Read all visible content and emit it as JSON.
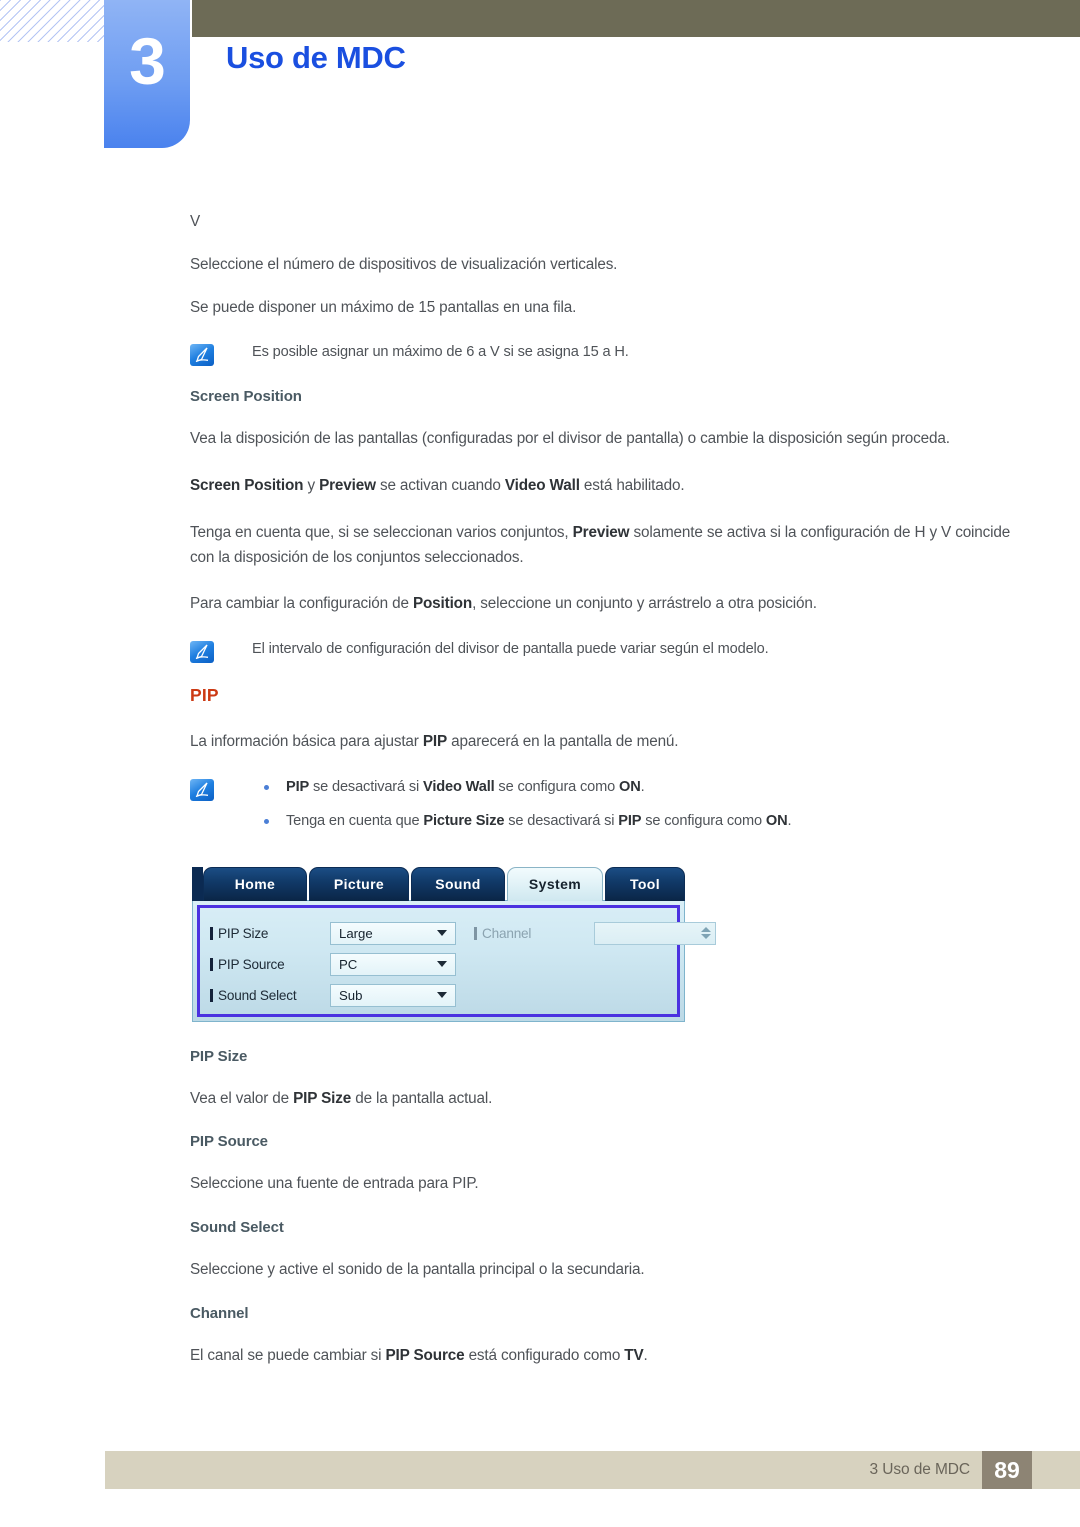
{
  "header": {
    "chapter_number": "3",
    "chapter_title": "Uso de MDC"
  },
  "body": {
    "v_heading": "V",
    "v_line1": "Seleccione el número de dispositivos de visualización verticales.",
    "v_line2": "Se puede disponer un máximo de 15 pantallas en una fila.",
    "note1": "Es posible asignar un máximo de 6 a V si se asigna 15 a H.",
    "screen_position_heading": "Screen Position",
    "sp_para1": "Vea la disposición de las pantallas (configuradas por el divisor de pantalla) o cambie la disposición según proceda.",
    "sp_para2_a": "Screen Position",
    "sp_para2_b": " y ",
    "sp_para2_c": "Preview",
    "sp_para2_d": " se activan cuando ",
    "sp_para2_e": "Video Wall",
    "sp_para2_f": " está habilitado.",
    "sp_para3_a": "Tenga en cuenta que, si se seleccionan varios conjuntos, ",
    "sp_para3_b": "Preview",
    "sp_para3_c": " solamente se activa si la configuración de H y V coincide con la disposición de los conjuntos seleccionados.",
    "sp_para4_a": "Para cambiar la configuración de ",
    "sp_para4_b": "Position",
    "sp_para4_c": ", seleccione un conjunto y arrástrelo a otra posición.",
    "note2": "El intervalo de configuración del divisor de pantalla puede variar según el modelo.",
    "pip_heading": "PIP",
    "pip_intro_a": "La información básica para ajustar ",
    "pip_intro_b": "PIP",
    "pip_intro_c": " aparecerá en la pantalla de menú.",
    "pip_bullet1_a": "PIP",
    "pip_bullet1_b": " se desactivará si ",
    "pip_bullet1_c": "Video Wall",
    "pip_bullet1_d": " se configura como ",
    "pip_bullet1_e": "ON",
    "pip_bullet1_f": ".",
    "pip_bullet2_a": "Tenga en cuenta que ",
    "pip_bullet2_b": "Picture Size",
    "pip_bullet2_c": " se desactivará si ",
    "pip_bullet2_d": "PIP",
    "pip_bullet2_e": " se configura como ",
    "pip_bullet2_f": "ON",
    "pip_bullet2_g": ".",
    "pipsize_heading": "PIP Size",
    "pipsize_text_a": "Vea el valor de ",
    "pipsize_text_b": "PIP Size",
    "pipsize_text_c": " de la pantalla actual.",
    "pipsource_heading": "PIP Source",
    "pipsource_text": "Seleccione una fuente de entrada para PIP.",
    "soundselect_heading": "Sound Select",
    "soundselect_text": "Seleccione y active el sonido de la pantalla principal o la secundaria.",
    "channel_heading": "Channel",
    "channel_text_a": "El canal se puede cambiar si ",
    "channel_text_b": "PIP Source",
    "channel_text_c": " está configurado como ",
    "channel_text_d": "TV",
    "channel_text_e": "."
  },
  "mdc_dialog": {
    "tabs": [
      {
        "label": "Home",
        "active": false
      },
      {
        "label": "Picture",
        "active": false
      },
      {
        "label": "Sound",
        "active": false
      },
      {
        "label": "System",
        "active": true
      },
      {
        "label": "Tool",
        "active": false
      }
    ],
    "fields_left": [
      {
        "label": "PIP Size",
        "value": "Large",
        "enabled": true
      },
      {
        "label": "PIP Source",
        "value": "PC",
        "enabled": true
      },
      {
        "label": "Sound Select",
        "value": "Sub",
        "enabled": true
      }
    ],
    "fields_right": [
      {
        "label": "Channel",
        "value": "",
        "enabled": false
      }
    ]
  },
  "footer": {
    "text": "3 Uso de MDC",
    "page": "89"
  },
  "colors": {
    "chapter_title": "#1a4fe0",
    "chapter_tab": "#6e9df2",
    "header_bar": "#6d6b56",
    "section_heading": "#cc3a14",
    "subheading": "#4a5a63",
    "body_text": "#4f5358",
    "footer_bar": "#d7d2bf",
    "footer_page_box": "#8d8474",
    "dialog_border": "#4b32e0",
    "tab_dark": "#113a69"
  }
}
